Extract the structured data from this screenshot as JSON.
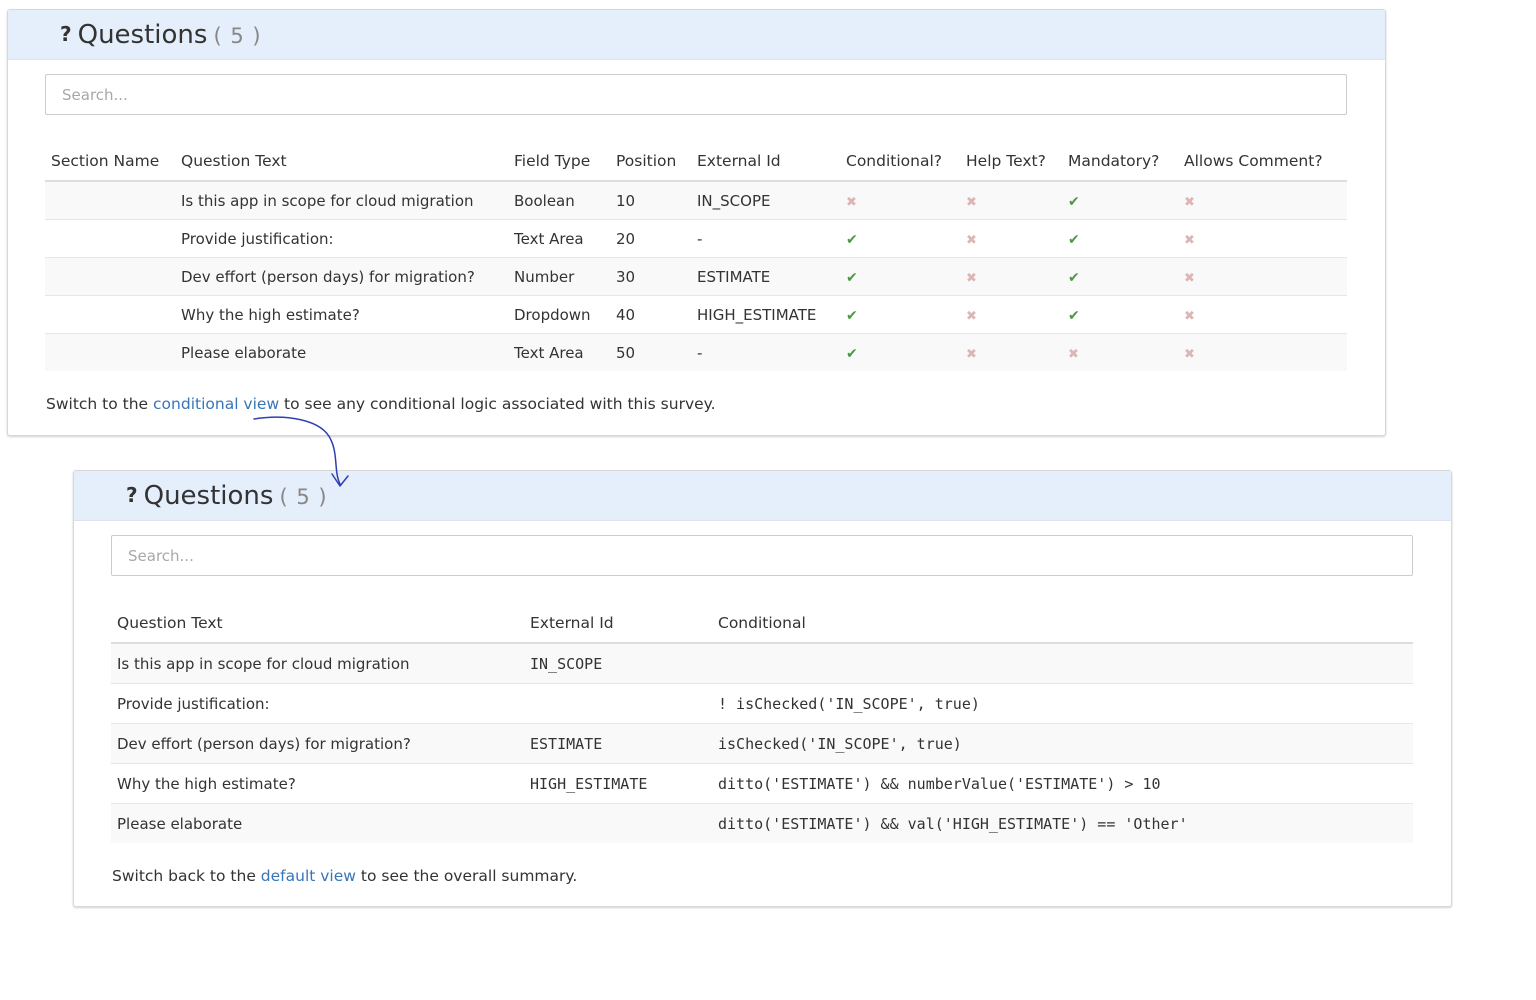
{
  "default_panel": {
    "title": "Questions",
    "count": "( 5 )",
    "search_placeholder": "Search...",
    "columns": [
      "Section Name",
      "Question Text",
      "Field Type",
      "Position",
      "External Id",
      "Conditional?",
      "Help Text?",
      "Mandatory?",
      "Allows Comment?"
    ],
    "rows": [
      {
        "section": "",
        "question": "Is this app in scope for cloud migration",
        "field_type": "Boolean",
        "position": "10",
        "external_id": "IN_SCOPE",
        "conditional": false,
        "help_text": false,
        "mandatory": true,
        "allows_comment": false
      },
      {
        "section": "",
        "question": "Provide justification:",
        "field_type": "Text Area",
        "position": "20",
        "external_id": "-",
        "conditional": true,
        "help_text": false,
        "mandatory": true,
        "allows_comment": false
      },
      {
        "section": "",
        "question": "Dev effort (person days) for migration?",
        "field_type": "Number",
        "position": "30",
        "external_id": "ESTIMATE",
        "conditional": true,
        "help_text": false,
        "mandatory": true,
        "allows_comment": false
      },
      {
        "section": "",
        "question": "Why the high estimate?",
        "field_type": "Dropdown",
        "position": "40",
        "external_id": "HIGH_ESTIMATE",
        "conditional": true,
        "help_text": false,
        "mandatory": true,
        "allows_comment": false
      },
      {
        "section": "",
        "question": "Please elaborate",
        "field_type": "Text Area",
        "position": "50",
        "external_id": "-",
        "conditional": true,
        "help_text": false,
        "mandatory": false,
        "allows_comment": false
      }
    ],
    "footer": {
      "before": "Switch to the ",
      "link": "conditional view",
      "after": " to see any conditional logic associated with this survey."
    }
  },
  "conditional_panel": {
    "title": "Questions",
    "count": "( 5 )",
    "search_placeholder": "Search...",
    "columns": [
      "Question Text",
      "External Id",
      "Conditional"
    ],
    "rows": [
      {
        "question": "Is this app in scope for cloud migration",
        "external_id": "IN_SCOPE",
        "conditional": ""
      },
      {
        "question": "Provide justification:",
        "external_id": "",
        "conditional": "! isChecked('IN_SCOPE', true)"
      },
      {
        "question": "Dev effort (person days) for migration?",
        "external_id": "ESTIMATE",
        "conditional": "isChecked('IN_SCOPE', true)"
      },
      {
        "question": "Why the high estimate?",
        "external_id": "HIGH_ESTIMATE",
        "conditional": "ditto('ESTIMATE') && numberValue('ESTIMATE') > 10"
      },
      {
        "question": "Please elaborate",
        "external_id": "",
        "conditional": "ditto('ESTIMATE') && val('HIGH_ESTIMATE') == 'Other'"
      }
    ],
    "footer": {
      "before": "Switch back to the ",
      "link": "default view",
      "after": " to see the overall summary."
    }
  },
  "icons": {
    "check": "check-icon",
    "cross": "cross-icon",
    "question": "question-mark-icon"
  },
  "colors": {
    "header_bg": "#e5eefb",
    "link": "#3875b8",
    "check": "#4a9a3f",
    "cross": "#dcb5b5",
    "arrow": "#2f3fb0"
  }
}
